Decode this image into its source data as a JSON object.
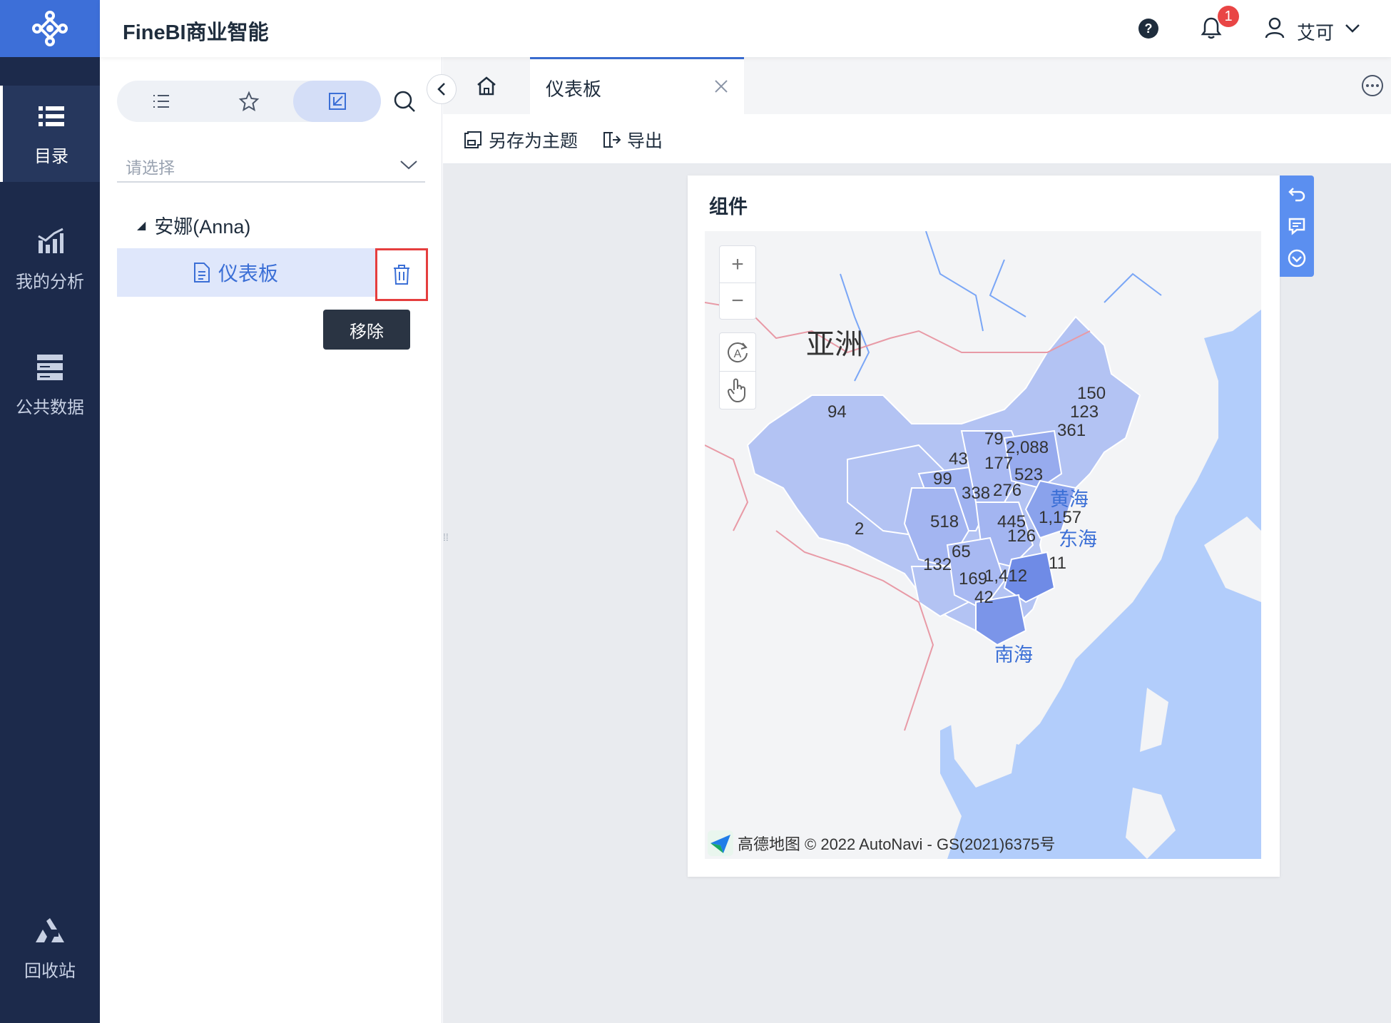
{
  "app": {
    "title": "FineBI商业智能"
  },
  "nav": {
    "items": [
      {
        "label": "目录",
        "icon": "list-icon",
        "active": true
      },
      {
        "label": "我的分析",
        "icon": "chart-icon",
        "active": false
      },
      {
        "label": "公共数据",
        "icon": "database-icon",
        "active": false
      },
      {
        "label": "回收站",
        "icon": "recycle-icon",
        "active": false
      }
    ]
  },
  "header": {
    "notification_count": "1",
    "user_name": "艾可"
  },
  "catalog": {
    "select_placeholder": "请选择",
    "tree_root": "安娜(Anna)",
    "tree_item": "仪表板",
    "tooltip": "移除"
  },
  "tabs": {
    "active_tab": "仪表板"
  },
  "toolbar": {
    "save_as_theme": "另存为主题",
    "export": "导出"
  },
  "widget": {
    "title": "组件",
    "continent_label": "亚洲",
    "seas": [
      "黄海",
      "东海",
      "南海"
    ],
    "attribution": "© 2022 AutoNavi - GS(2021)6375号",
    "map_brand": "高德地图",
    "values": [
      "94",
      "150",
      "123",
      "361",
      "79",
      "2,088",
      "43",
      "177",
      "523",
      "99",
      "338",
      "276",
      "1,157",
      "518",
      "445",
      "126",
      "2",
      "65",
      "132",
      "169",
      "1,412",
      "11",
      "42"
    ]
  },
  "colors": {
    "accent": "#3b6fd6",
    "nav_bg": "#1c2a4b",
    "logo_bg": "#3d6fd8",
    "danger": "#e53e3e"
  }
}
